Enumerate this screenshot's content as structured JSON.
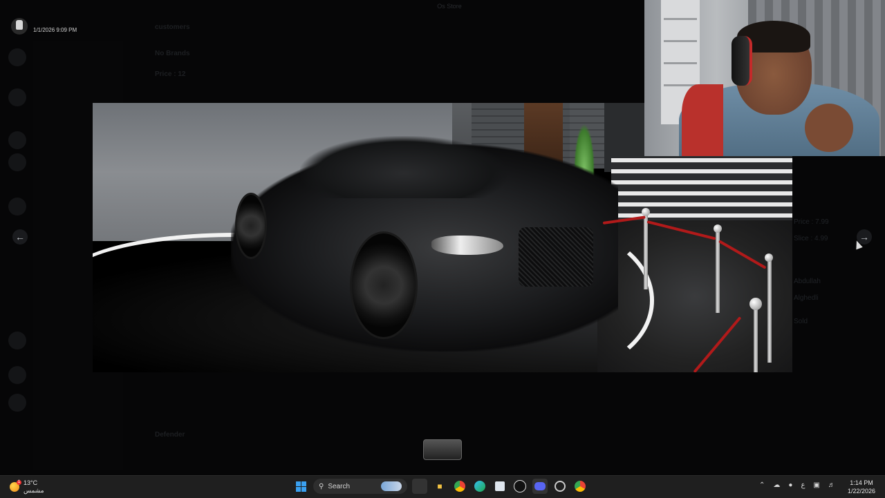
{
  "window": {
    "title": "Os Store"
  },
  "uploader": {
    "timestamp": "1/1/2026 9:09 PM"
  },
  "background": {
    "header_channel": "customers",
    "post_line_1": "No Brands",
    "post_line_2": "Price : 12",
    "footer_label": "Defender",
    "channels": [
      "",
      "",
      "",
      "",
      "",
      "",
      "",
      "",
      "",
      "",
      "",
      "",
      "",
      ""
    ],
    "right_list": [
      "Price : 7.99",
      "Slice : 4.99",
      "Abdullah",
      "Alghedli",
      "Sold"
    ]
  },
  "viewer": {
    "prev_label": "←",
    "next_label": "→"
  },
  "taskbar": {
    "weather_temp": "13°C",
    "weather_desc": "مشمس",
    "weather_badge": "1",
    "search_label": "Search",
    "tray_lang": "ع",
    "time": "1:14 PM",
    "date": "1/22/2026"
  },
  "colors": {
    "accent": "#3aa0f0",
    "rope": "#b11a1a",
    "taskbar": "#1f1f1f"
  },
  "icons": [
    "windows-start-icon",
    "search-icon",
    "task-view-icon",
    "file-explorer-icon",
    "chrome-icon",
    "edge-icon",
    "store-icon",
    "app-icon",
    "discord-icon",
    "steam-icon",
    "chrome-profile-icon"
  ]
}
